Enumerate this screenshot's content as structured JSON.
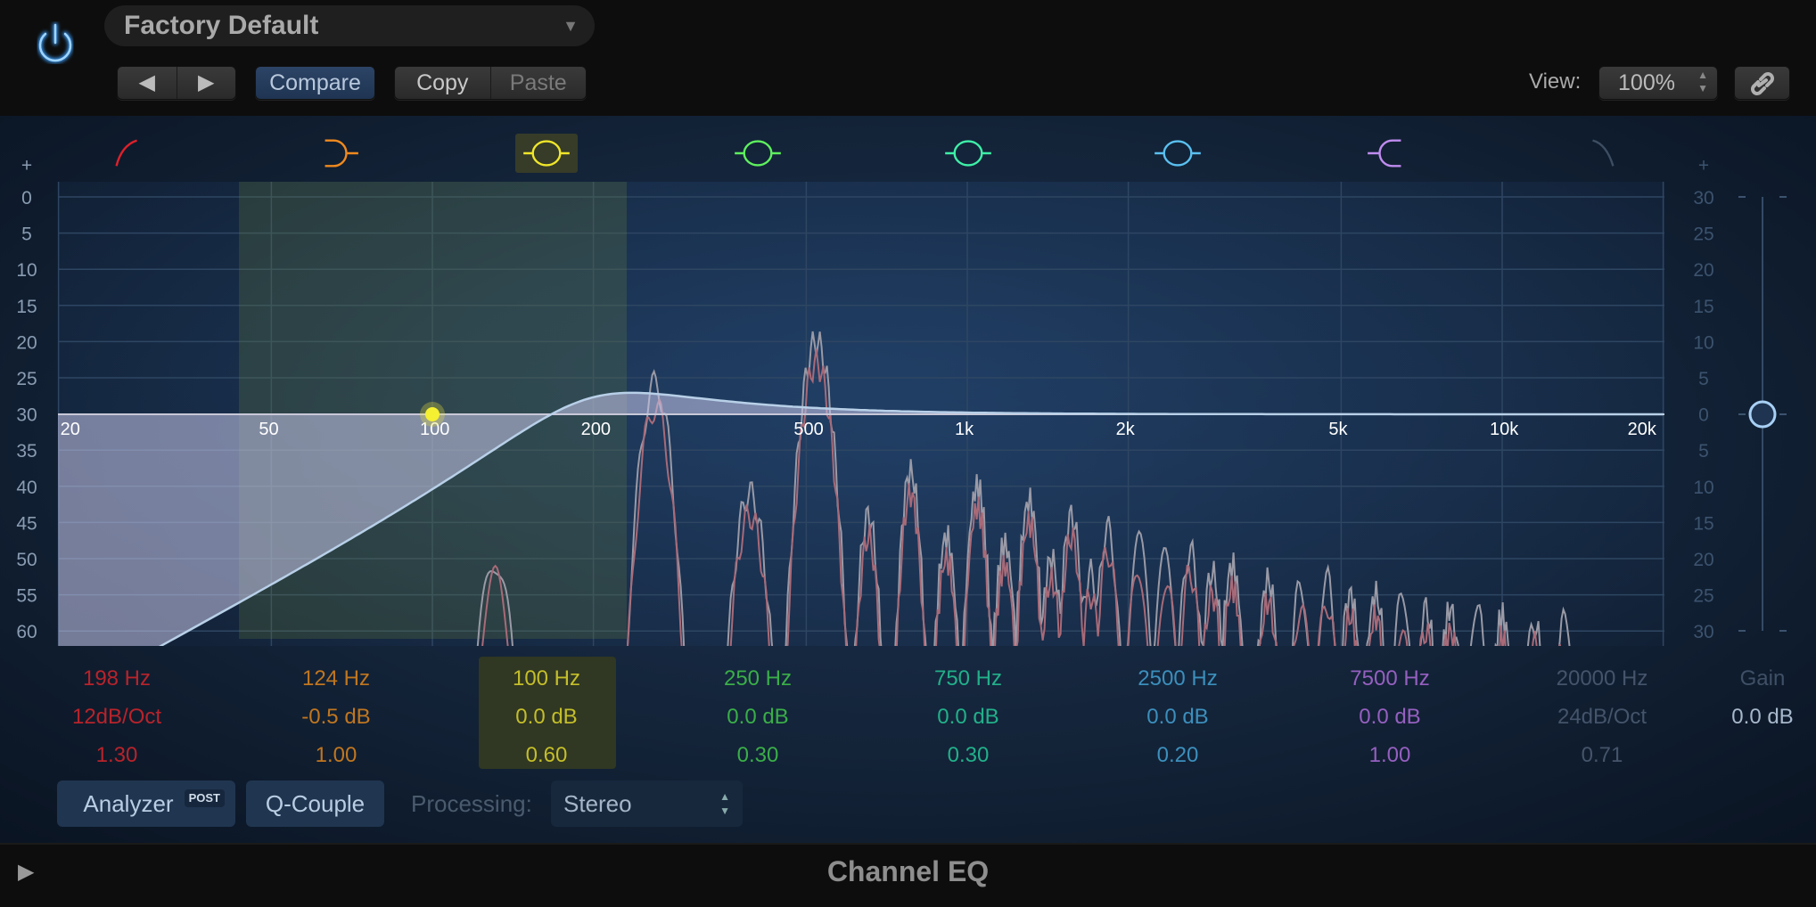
{
  "header": {
    "preset": "Factory Default",
    "compare": "Compare",
    "copy": "Copy",
    "paste": "Paste",
    "view_label": "View:",
    "view_value": "100%",
    "power_on": true,
    "accent": "#3aa0ff"
  },
  "bands": [
    {
      "type": "low-cut",
      "icon": "low-cut-icon",
      "color": "#e0202a",
      "text_color": "#b8232b",
      "freq": "198 Hz",
      "gain": "12dB/Oct",
      "q": "1.30"
    },
    {
      "type": "low-shelf",
      "icon": "low-shelf-icon",
      "color": "#f08a1e",
      "text_color": "#c0761f",
      "freq": "124 Hz",
      "gain": "-0.5 dB",
      "q": "1.00"
    },
    {
      "type": "bell",
      "icon": "bell-icon",
      "color": "#f0e62a",
      "text_color": "#c4be2a",
      "freq": "100 Hz",
      "gain": "0.0 dB",
      "q": "0.60",
      "selected": true
    },
    {
      "type": "bell",
      "icon": "bell-icon",
      "color": "#5ef05e",
      "text_color": "#3aae48",
      "freq": "250 Hz",
      "gain": "0.0 dB",
      "q": "0.30"
    },
    {
      "type": "bell",
      "icon": "bell-icon",
      "color": "#3ef0a8",
      "text_color": "#22b08a",
      "freq": "750 Hz",
      "gain": "0.0 dB",
      "q": "0.30"
    },
    {
      "type": "bell",
      "icon": "bell-icon",
      "color": "#5ac0f0",
      "text_color": "#3c8fbc",
      "freq": "2500 Hz",
      "gain": "0.0 dB",
      "q": "0.20"
    },
    {
      "type": "high-shelf",
      "icon": "high-shelf-icon",
      "color": "#c08cf0",
      "text_color": "#9560c0",
      "freq": "7500 Hz",
      "gain": "0.0 dB",
      "q": "1.00"
    },
    {
      "type": "high-cut",
      "icon": "high-cut-icon",
      "color": "#3e4e62",
      "text_color": "#45546a",
      "freq": "20000 Hz",
      "gain": "24dB/Oct",
      "q": "0.71",
      "disabled": true
    }
  ],
  "gain": {
    "label": "Gain",
    "value": "0.0 dB",
    "db": 0
  },
  "footer": {
    "analyzer": "Analyzer",
    "post": "POST",
    "qcouple": "Q-Couple",
    "processing_label": "Processing:",
    "processing_value": "Stereo",
    "plugin_name": "Channel EQ"
  },
  "chart_data": {
    "type": "line",
    "x_scale": "log",
    "xlim": [
      20,
      20000
    ],
    "x_ticks": [
      {
        "label": "20",
        "hz": 20
      },
      {
        "label": "50",
        "hz": 50
      },
      {
        "label": "100",
        "hz": 100
      },
      {
        "label": "200",
        "hz": 200
      },
      {
        "label": "500",
        "hz": 500
      },
      {
        "label": "1k",
        "hz": 1000
      },
      {
        "label": "2k",
        "hz": 2000
      },
      {
        "label": "5k",
        "hz": 5000
      },
      {
        "label": "10k",
        "hz": 10000
      },
      {
        "label": "20k",
        "hz": 20000
      }
    ],
    "left_axis": {
      "ticks": [
        "+",
        "0",
        "5",
        "10",
        "15",
        "20",
        "25",
        "30",
        "35",
        "40",
        "45",
        "50",
        "55",
        "60",
        "-"
      ],
      "range_db": [
        0,
        -60
      ]
    },
    "right_axis": {
      "ticks": [
        "+",
        "30",
        "25",
        "20",
        "15",
        "10",
        "5",
        "0",
        "5",
        "10",
        "15",
        "20",
        "25",
        "30",
        "-"
      ],
      "range_db": [
        30,
        -30
      ]
    },
    "eq_curve": {
      "highpass_hz": 198,
      "slope": "12dB/Oct",
      "q": 1.3
    },
    "selected_band_hz": 100,
    "analyzer_peaks": [
      [
        131,
        -50
      ],
      [
        261,
        -26
      ],
      [
        392,
        -41
      ],
      [
        522,
        -20
      ],
      [
        653,
        -44
      ],
      [
        783,
        -38
      ],
      [
        914,
        -47
      ],
      [
        1044,
        -40
      ],
      [
        1175,
        -48
      ],
      [
        1305,
        -42
      ],
      [
        1436,
        -50
      ],
      [
        1566,
        -44
      ],
      [
        1700,
        -52
      ],
      [
        1830,
        -46
      ],
      [
        2090,
        -48
      ],
      [
        2350,
        -50
      ],
      [
        2610,
        -49
      ],
      [
        2870,
        -52
      ],
      [
        3130,
        -51
      ],
      [
        3650,
        -53
      ],
      [
        4200,
        -54
      ],
      [
        4700,
        -53
      ],
      [
        5200,
        -55
      ],
      [
        5800,
        -55
      ],
      [
        6500,
        -56
      ],
      [
        7200,
        -57
      ],
      [
        8000,
        -57
      ],
      [
        9000,
        -58
      ],
      [
        10000,
        -58
      ],
      [
        11500,
        -59
      ],
      [
        13000,
        -59
      ]
    ]
  }
}
